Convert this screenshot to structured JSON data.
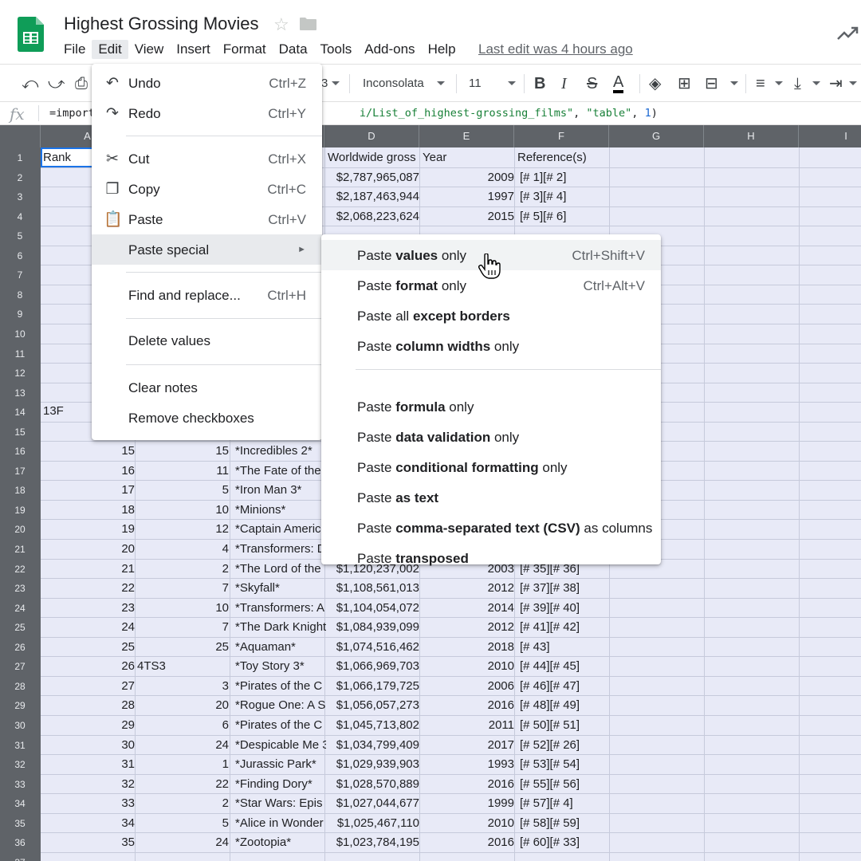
{
  "header": {
    "title": "Highest Grossing Movies",
    "last_edit": "Last edit was 4 hours ago",
    "menu": [
      "File",
      "Edit",
      "View",
      "Insert",
      "Format",
      "Data",
      "Tools",
      "Add-ons",
      "Help"
    ]
  },
  "toolbar": {
    "zoom_partial": "3",
    "font": "Inconsolata",
    "font_size": "11",
    "icons": [
      "undo-icon",
      "redo-icon",
      "print-icon",
      "bold-icon",
      "italic-icon",
      "strikethrough-icon",
      "text-color-icon",
      "fill-color-icon",
      "borders-icon",
      "merge-cells-icon",
      "horizontal-align-icon",
      "vertical-align-icon",
      "text-wrap-icon"
    ]
  },
  "formula_bar": {
    "fx": "fx",
    "prefix": "=import",
    "url_tail": "i/List_of_highest-grossing_films\"",
    "sep1": ", ",
    "arg2": "\"table\"",
    "sep2": ", ",
    "arg3": "1",
    "close": ")"
  },
  "grid": {
    "columns": [
      "A",
      "",
      "",
      "D",
      "E",
      "F",
      "G",
      "H",
      "I"
    ],
    "header_row": {
      "a": "Rank",
      "d": "Worldwide gross",
      "e": "Year",
      "f": "Reference(s)"
    },
    "rows_top": [
      {
        "d": "$2,787,965,087",
        "e": "2009",
        "f": "[# 1][# 2]"
      },
      {
        "d": "$2,187,463,944",
        "e": "1997",
        "f": "[# 3][# 4]"
      },
      {
        "d": "$2,068,223,624",
        "e": "2015",
        "f": "[# 5][# 6]"
      }
    ],
    "row14_a": "13F",
    "rows_mid": [
      {
        "a": "15",
        "b": "15",
        "c": "*Incredibles 2*"
      },
      {
        "a": "16",
        "b": "11",
        "c": "*The Fate of the"
      },
      {
        "a": "17",
        "b": "5",
        "c": "*Iron Man 3*"
      },
      {
        "a": "18",
        "b": "10",
        "c": "*Minions*"
      },
      {
        "a": "19",
        "b": "12",
        "c": "*Captain Americ"
      },
      {
        "a": "20",
        "b": "4",
        "c": "*Transformers: D"
      }
    ],
    "rows_bottom": [
      {
        "a": "21",
        "b": "2",
        "c": "*The Lord of the",
        "d": "$1,120,237,002",
        "e": "2003",
        "f": "[# 35][# 36]"
      },
      {
        "a": "22",
        "b": "7",
        "c": "*Skyfall*",
        "d": "$1,108,561,013",
        "e": "2012",
        "f": "[# 37][# 38]"
      },
      {
        "a": "23",
        "b": "10",
        "c": "*Transformers: A",
        "d": "$1,104,054,072",
        "e": "2014",
        "f": "[# 39][# 40]"
      },
      {
        "a": "24",
        "b": "7",
        "c": "*The Dark Knight",
        "d": "$1,084,939,099",
        "e": "2012",
        "f": "[# 41][# 42]"
      },
      {
        "a": "25",
        "b": "25",
        "c": "*Aquaman*",
        "d": "$1,074,516,462",
        "e": "2018",
        "f": "[# 43]"
      },
      {
        "a": "26",
        "b": "4TS3",
        "c": "*Toy Story 3*",
        "d": "$1,066,969,703",
        "e": "2010",
        "f": "[# 44][# 45]"
      },
      {
        "a": "27",
        "b": "3",
        "c": "*Pirates of the C",
        "d": "$1,066,179,725",
        "e": "2006",
        "f": "[# 46][# 47]"
      },
      {
        "a": "28",
        "b": "20",
        "c": "*Rogue One: A S",
        "d": "$1,056,057,273",
        "e": "2016",
        "f": "[# 48][# 49]"
      },
      {
        "a": "29",
        "b": "6",
        "c": "*Pirates of the C",
        "d": "$1,045,713,802",
        "e": "2011",
        "f": "[# 50][# 51]"
      },
      {
        "a": "30",
        "b": "24",
        "c": "*Despicable Me 3",
        "d": "$1,034,799,409",
        "e": "2017",
        "f": "[# 52][# 26]"
      },
      {
        "a": "31",
        "b": "1",
        "c": "*Jurassic Park*",
        "d": "$1,029,939,903",
        "e": "1993",
        "f": "[# 53][# 54]"
      },
      {
        "a": "32",
        "b": "22",
        "c": "*Finding Dory*",
        "d": "$1,028,570,889",
        "e": "2016",
        "f": "[# 55][# 56]"
      },
      {
        "a": "33",
        "b": "2",
        "c": "*Star Wars: Epis",
        "d": "$1,027,044,677",
        "e": "1999",
        "f": "[# 57][# 4]"
      },
      {
        "a": "34",
        "b": "5",
        "c": "*Alice in Wonder",
        "d": "$1,025,467,110",
        "e": "2010",
        "f": "[# 58][# 59]"
      },
      {
        "a": "35",
        "b": "24",
        "c": "*Zootopia*",
        "d": "$1,023,784,195",
        "e": "2016",
        "f": "[# 60][# 33]"
      }
    ]
  },
  "edit_menu": {
    "items": [
      {
        "label": "Undo",
        "shortcut": "Ctrl+Z",
        "icon": "undo-icon"
      },
      {
        "label": "Redo",
        "shortcut": "Ctrl+Y",
        "icon": "redo-icon"
      },
      {
        "label": "Cut",
        "shortcut": "Ctrl+X",
        "icon": "cut-icon"
      },
      {
        "label": "Copy",
        "shortcut": "Ctrl+C",
        "icon": "copy-icon"
      },
      {
        "label": "Paste",
        "shortcut": "Ctrl+V",
        "icon": "paste-icon"
      },
      {
        "label": "Paste special",
        "arrow": "►"
      },
      {
        "label": "Find and replace...",
        "shortcut": "Ctrl+H"
      },
      {
        "label": "Delete values"
      },
      {
        "label": "Clear notes"
      },
      {
        "label": "Remove checkboxes"
      }
    ]
  },
  "paste_special": {
    "items": [
      {
        "pre": "Paste ",
        "bold": "values",
        "post": " only",
        "shortcut": "Ctrl+Shift+V"
      },
      {
        "pre": "Paste ",
        "bold": "format",
        "post": " only",
        "shortcut": "Ctrl+Alt+V"
      },
      {
        "pre": "Paste all ",
        "bold": "except borders",
        "post": ""
      },
      {
        "pre": "Paste ",
        "bold": "column widths",
        "post": " only"
      },
      {
        "pre": "Paste ",
        "bold": "formula",
        "post": " only"
      },
      {
        "pre": "Paste ",
        "bold": "data validation",
        "post": " only"
      },
      {
        "pre": "Paste ",
        "bold": "conditional formatting",
        "post": " only"
      },
      {
        "pre": "Paste ",
        "bold": "as text",
        "post": ""
      },
      {
        "pre": "Paste ",
        "bold": "comma-separated text (CSV)",
        "post": " as columns"
      },
      {
        "pre": "Paste ",
        "bold": "transposed",
        "post": ""
      }
    ]
  },
  "colors": {
    "brand_green": "#0f9d58",
    "header_gray": "#5f6368",
    "selection_blue": "#1a73e8",
    "cell_tint": "#e8eaf7"
  }
}
